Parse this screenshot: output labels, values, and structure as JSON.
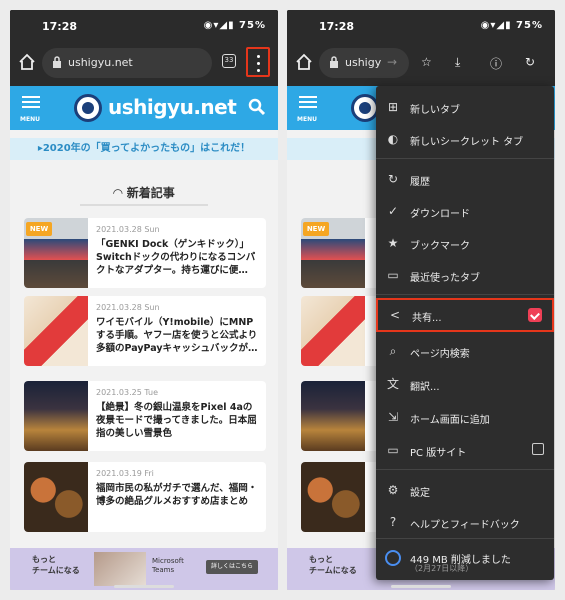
{
  "status": {
    "time": "17:28",
    "icons": "◉▾◢▮ 75%"
  },
  "browser": {
    "url": "ushigyu.net",
    "tab_count": "33",
    "url_truncated": "ushigy"
  },
  "site": {
    "logo": "ushigyu.net",
    "menu_label": "MENU",
    "banner": "▸2020年の「買ってよかったもの」はこれだ！",
    "section_title": "新着記事",
    "new_badge": "NEW",
    "articles": [
      {
        "date": "2021.03.28 Sun",
        "title": "「GENKI Dock（ゲンキドック）」Switchドックの代わりになるコンパクトなアダプター。持ち運びに便…"
      },
      {
        "date": "2021.03.28 Sun",
        "title": "ワイモバイル（Y!mobile）にMNPする手順。ヤフー店を使うと公式より多額のPayPayキャッシュバックが…"
      },
      {
        "date": "2021.03.25 Tue",
        "title": "【絶景】冬の銀山温泉をPixel 4aの夜景モードで撮ってきました。日本屈指の美しい雪景色"
      },
      {
        "date": "2021.03.19 Fri",
        "title": "福岡市民の私がガチで選んだ、福岡・博多の絶品グルメおすすめ店まとめ"
      }
    ],
    "ad": {
      "text_line1": "もっと",
      "text_line2": "チームになる",
      "brand_line1": "Microsoft",
      "brand_line2": "Teams",
      "button": "詳しくはこちら"
    }
  },
  "menu": {
    "items": [
      {
        "icon": "⊞",
        "label": "新しいタブ"
      },
      {
        "icon": "◐",
        "label": "新しいシークレット タブ"
      },
      {
        "icon": "↻",
        "label": "履歴"
      },
      {
        "icon": "✓",
        "label": "ダウンロード"
      },
      {
        "icon": "★",
        "label": "ブックマーク"
      },
      {
        "icon": "▭",
        "label": "最近使ったタブ"
      },
      {
        "icon": "<",
        "label": "共有..."
      },
      {
        "icon": "⌕",
        "label": "ページ内検索"
      },
      {
        "icon": "文",
        "label": "翻訳..."
      },
      {
        "icon": "⇲",
        "label": "ホーム画面に追加"
      },
      {
        "icon": "▭",
        "label": "PC 版サイト"
      },
      {
        "icon": "⚙",
        "label": "設定"
      },
      {
        "icon": "?",
        "label": "ヘルプとフィードバック"
      }
    ],
    "savings": {
      "label": "449 MB 削減しました",
      "sublabel": "（2月27日以降）"
    }
  },
  "colors": {
    "site_header": "#2ea8e5",
    "highlight": "#e5361b",
    "menu_bg": "#2d2d2d"
  }
}
